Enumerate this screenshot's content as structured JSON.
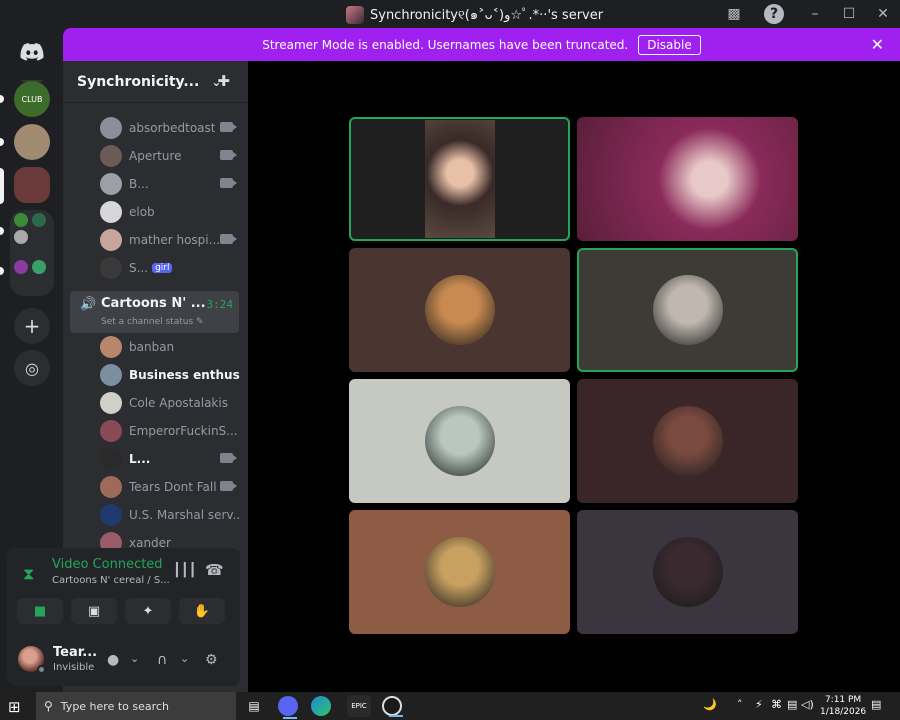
{
  "window": {
    "title": "Synchronicity୧(๑˃ᴗ˂)ﻭ☆ﾟ.*‧‧'s server",
    "controls": [
      "–",
      "☐",
      "✕"
    ]
  },
  "banner": {
    "text": "Streamer Mode is enabled. Usernames have been truncated.",
    "button": "Disable",
    "color": "#a020f0"
  },
  "guilds": {
    "home_icon": "discord-logo",
    "add_label": "+",
    "discover_label": "◎"
  },
  "server": {
    "name": "Synchronicity...",
    "chevron": "⌄",
    "invite_icon": "👤+"
  },
  "members_top": [
    {
      "name": "absorbedtoast",
      "camera": true,
      "color": "#8a8f99"
    },
    {
      "name": "Aperture",
      "camera": true,
      "color": "#6b5a55"
    },
    {
      "name": "B...",
      "camera": true,
      "color": "#9aa0a6"
    },
    {
      "name": "elob",
      "camera": false,
      "color": "#d7d7d7"
    },
    {
      "name": "mather hospi...",
      "camera": true,
      "color": "#c9a49a"
    },
    {
      "name": "S...",
      "camera": false,
      "color": "#3a3a3a",
      "tag": "girl"
    }
  ],
  "voice_channel": {
    "name": "Cartoons N' ...",
    "timer": "3:24",
    "status": "Set a channel status ✎"
  },
  "members_vc": [
    {
      "name": "banban",
      "camera": false,
      "color": "#b8866b",
      "bright": false
    },
    {
      "name": "Business enthusi...",
      "camera": false,
      "color": "#7a8fa0",
      "bright": true
    },
    {
      "name": "Cole Apostalakis",
      "camera": false,
      "color": "#d0cfc8",
      "bright": false
    },
    {
      "name": "EmperorFuckinS...",
      "camera": false,
      "color": "#8a4a55",
      "bright": false
    },
    {
      "name": "L...",
      "camera": true,
      "color": "#2a2a2a",
      "bright": true
    },
    {
      "name": "Tears Dont Fall",
      "camera": true,
      "color": "#a06a5a",
      "bright": false
    },
    {
      "name": "U.S. Marshal serv...",
      "camera": false,
      "color": "#1f3a6e",
      "bright": false
    },
    {
      "name": "xander",
      "camera": false,
      "color": "#9a5a6a",
      "bright": false
    }
  ],
  "voice_panel": {
    "title": "Video Connected",
    "subtitle": "Cartoons N' cereal / S...",
    "wave_icon": "┃┃┃",
    "hangup_icon": "☎",
    "buttons": [
      "■",
      "▣",
      "✦",
      "✋"
    ]
  },
  "user": {
    "name": "Tear...",
    "status": "Invisible",
    "mic_icon": "🎙",
    "headset_icon": "∩",
    "settings_icon": "⚙",
    "dropdown": "⌄"
  },
  "tiles": [
    {
      "bg": "#1f1f1f",
      "face": "#c8a090",
      "speaking": true,
      "kind": "cam"
    },
    {
      "bg": "#5a1f3a",
      "face": "#d8a8b0",
      "speaking": false,
      "kind": "cam"
    },
    {
      "bg": "#4a3530",
      "face": "#c88a50",
      "speaking": false,
      "kind": "avatar"
    },
    {
      "bg": "#3e3b36",
      "face": "#c0b8b0",
      "speaking": true,
      "kind": "avatar"
    },
    {
      "bg": "#c6c8c2",
      "face": "#b8c8c0",
      "speaking": false,
      "kind": "avatar"
    },
    {
      "bg": "#3a2528",
      "face": "#7a4a40",
      "speaking": false,
      "kind": "avatar"
    },
    {
      "bg": "#8e5c44",
      "face": "#c8a060",
      "speaking": false,
      "kind": "avatar"
    },
    {
      "bg": "#3b3540",
      "face": "#3a2a30",
      "speaking": false,
      "kind": "avatar"
    }
  ],
  "taskbar": {
    "search_placeholder": "Type here to search",
    "time": "7:11 PM",
    "date": "1/18/2026",
    "tray_icons": [
      "🌙",
      "˄",
      "⚡",
      "⌘",
      "▤",
      "◁)"
    ],
    "apps": [
      "▤",
      "discord",
      "edge",
      "EPIC",
      "obs"
    ]
  }
}
